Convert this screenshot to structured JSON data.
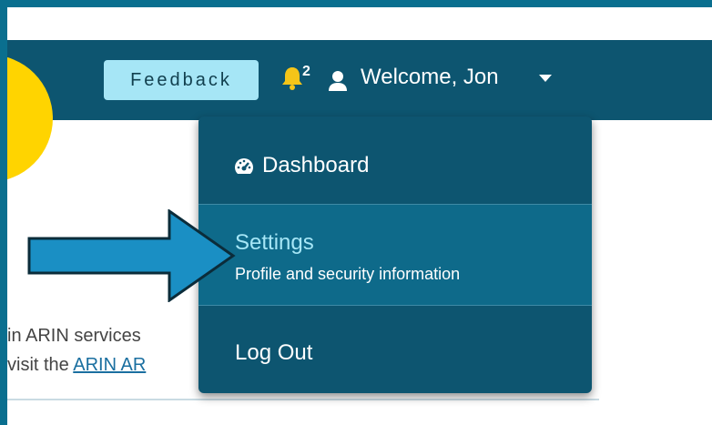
{
  "header": {
    "feedback_label": "Feedback",
    "notification_count": "2",
    "welcome_label": "Welcome, Jon"
  },
  "dropdown": {
    "dashboard_label": "Dashboard",
    "settings_label": "Settings",
    "settings_description": "Profile and security information",
    "logout_label": "Log Out"
  },
  "background": {
    "line1": "in ARIN services",
    "line2_prefix": "visit the ",
    "line2_link": "ARIN AR"
  },
  "colors": {
    "header_bg": "#0d5570",
    "feedback_bg": "#a6e6f6",
    "bell": "#f5c518",
    "arrow": "#1a8fc4",
    "highlight_circle": "#ffd400"
  },
  "icons": {
    "bell": "bell-icon",
    "user": "user-icon",
    "caret": "chevron-down-icon",
    "dashboard": "tachometer-icon",
    "arrow": "arrow-right-icon"
  }
}
